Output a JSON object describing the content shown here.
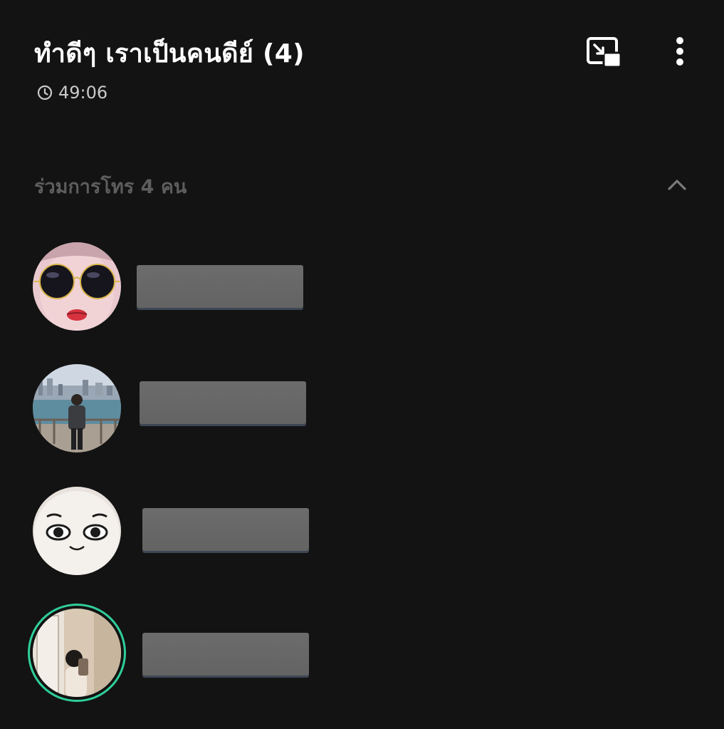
{
  "header": {
    "title": "ทำดีๆ เราเป็นคนดีย์ (4)",
    "timer_icon": "clock-icon",
    "duration": "49:06",
    "pip_icon": "picture-in-picture-icon",
    "more_icon": "more-vertical-icon"
  },
  "participants_section": {
    "label": "ร่วมการโทร 4 คน",
    "toggle_icon": "chevron-up-icon",
    "expanded": true
  },
  "participants": [
    {
      "avatar": "avatar-sunglasses-face",
      "speaking": false
    },
    {
      "avatar": "avatar-harbour-photo",
      "speaking": false
    },
    {
      "avatar": "avatar-plush-face",
      "speaking": false
    },
    {
      "avatar": "avatar-mirror-selfie",
      "speaking": true
    }
  ],
  "colors": {
    "background": "#131313",
    "title": "#ffffff",
    "muted_text": "#5e5e5e",
    "speaking_ring": "#2fcf9a",
    "name_redaction": "#666666"
  }
}
